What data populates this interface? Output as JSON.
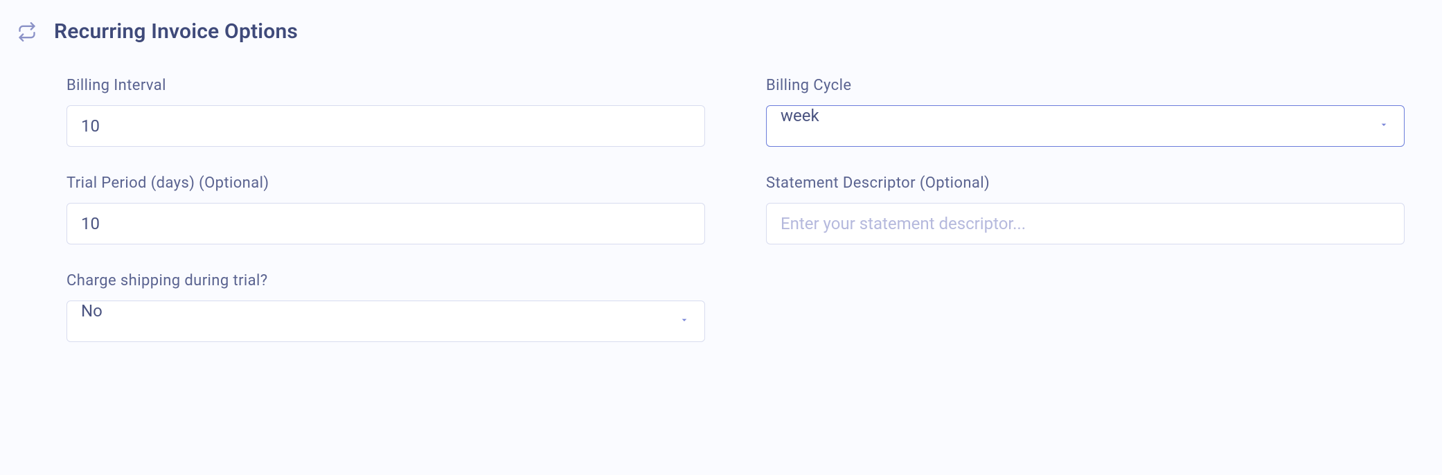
{
  "section": {
    "title": "Recurring Invoice Options"
  },
  "fields": {
    "billing_interval": {
      "label": "Billing Interval",
      "value": "10"
    },
    "billing_cycle": {
      "label": "Billing Cycle",
      "value": "week"
    },
    "trial_period": {
      "label": "Trial Period (days) (Optional)",
      "value": "10"
    },
    "statement_descriptor": {
      "label": "Statement Descriptor (Optional)",
      "placeholder": "Enter your statement descriptor...",
      "value": ""
    },
    "charge_shipping": {
      "label": "Charge shipping during trial?",
      "value": "No"
    }
  }
}
